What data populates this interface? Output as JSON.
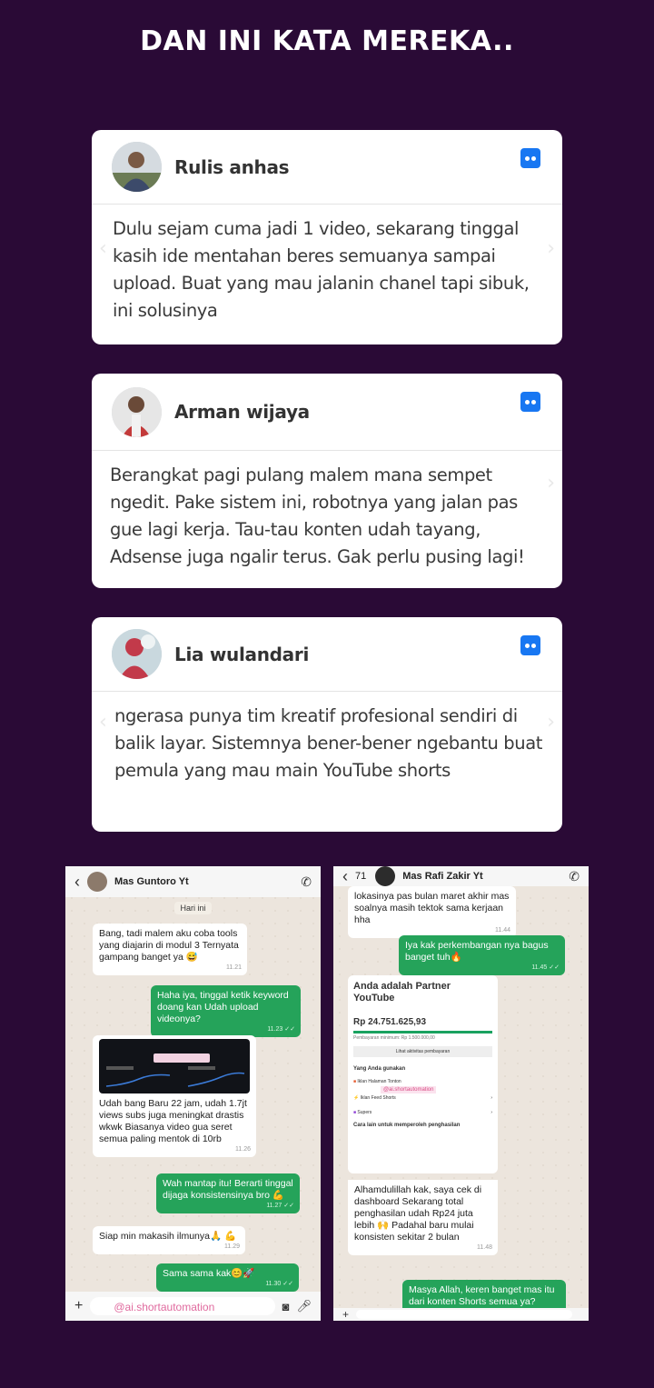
{
  "headline": "DAN INI KATA MEREKA..",
  "testimonials": [
    {
      "name": "Rulis anhas",
      "text": "Dulu sejam cuma jadi 1 video, sekarang tinggal kasih ide mentahan beres semuanya sampai upload. Buat yang mau jalanin chanel tapi sibuk, ini solusinya"
    },
    {
      "name": "Arman wijaya",
      "text": "Berangkat pagi pulang malem mana sempet ngedit. Pake sistem ini, robotnya yang jalan pas gue lagi kerja. Tau-tau konten udah tayang, Adsense juga ngalir terus. Gak perlu pusing lagi!"
    },
    {
      "name": "Lia wulandari",
      "text": "ngerasa punya tim kreatif profesional sendiri di balik layar. Sistemnya bener-bener ngebantu buat pemula yang mau main YouTube shorts"
    }
  ],
  "chat1": {
    "contact": "Mas Guntoro Yt",
    "day": "Hari ini",
    "m1": "Bang, tadi malem aku coba tools yang diajarin di modul 3 Ternyata gampang banget ya 😅",
    "t1": "11.21",
    "m2": "Haha iya, tinggal ketik keyword doang kan Udah upload videonya?",
    "t2": "11.23 ✓✓",
    "m3": "Udah bang Baru 22 jam, udah 1.7jt views subs juga meningkat drastis wkwk Biasanya video gua seret semua paling mentok di 10rb",
    "t3": "11.26",
    "m4": "Wah mantap itu! Berarti tinggal dijaga konsistensinya bro 💪",
    "t4": "11.27 ✓✓",
    "m5": "Siap min makasih ilmunya🙏 💪",
    "t5": "11.29",
    "m6": "Sama sama kak😊🚀",
    "t6": "11.30 ✓✓",
    "watermark": "@ai.shortautomation"
  },
  "chat2": {
    "contact": "Mas Rafi Zakir Yt",
    "back_count": "71",
    "m1": "lokasinya pas bulan maret akhir mas soalnya masih tektok sama kerjaan hha",
    "t1": "11.44",
    "m2": "Iya kak perkembangan nya bagus banget tuh🔥",
    "t2": "11.45 ✓✓",
    "earn_title": "Anda adalah Partner YouTube",
    "earn_amount": "Rp 24.751.625,93",
    "earn_min": "Pembayaran minimum: Rp 1.500.000,00",
    "earn_btn": "Lihat aktivitas pembayaran",
    "earn_uses": "Yang Anda gunakan",
    "earn_i1": "Iklan Halaman Tonton",
    "earn_i2": "Iklan Feed Shorts",
    "earn_i3": "Supers",
    "earn_more": "Cara lain untuk memperoleh penghasilan",
    "watermark": "@ai.shortautomation",
    "m3": "Alhamdulillah kak, saya cek di dashboard Sekarang total penghasilan udah Rp24 juta lebih 🙌 Padahal baru mulai konsisten sekitar 2 bulan",
    "t3": "11.48",
    "m4": "Masya Allah, keren banget mas itu dari konten Shorts semua ya?"
  }
}
